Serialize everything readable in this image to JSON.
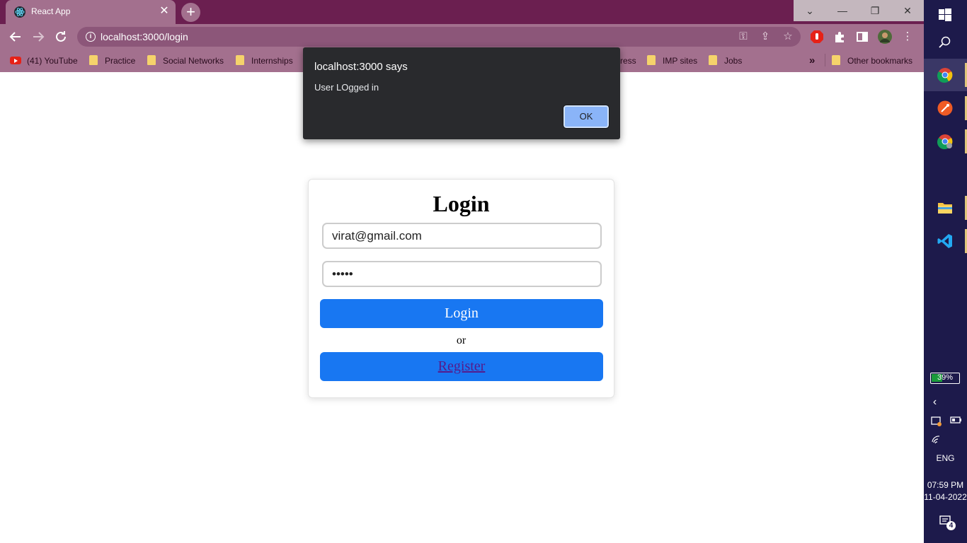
{
  "browser": {
    "tab": {
      "title": "React App",
      "close": "✕"
    },
    "new_tab": "+",
    "window_controls": {
      "tabsearch": "⌄",
      "minimize": "—",
      "restore": "❐",
      "close": "✕"
    },
    "url": "localhost:3000/login",
    "bookmarks": [
      {
        "label": "(41) YouTube",
        "icon": "youtube-icon"
      },
      {
        "label": "Practice",
        "icon": "folder-icon"
      },
      {
        "label": "Social Networks",
        "icon": "folder-icon"
      },
      {
        "label": "Internships",
        "icon": "folder-icon"
      },
      {
        "label": "ress",
        "icon": "folder-icon"
      },
      {
        "label": "IMP sites",
        "icon": "folder-icon"
      },
      {
        "label": "Jobs",
        "icon": "folder-icon"
      }
    ],
    "bookmarks_overflow": "»",
    "other_bookmarks": "Other bookmarks"
  },
  "alert": {
    "title": "localhost:3000 says",
    "message": "User LOgged in",
    "ok_label": "OK"
  },
  "login": {
    "title": "Login",
    "email_value": "virat@gmail.com",
    "password_value": "12345",
    "login_button": "Login",
    "or_text": "or",
    "register_link": "Register"
  },
  "taskbar": {
    "battery": "39%",
    "battery_level": 0.39,
    "language": "ENG",
    "time": "07:59 PM",
    "date": "11-04-2022",
    "notifications": "4"
  },
  "colors": {
    "tabstrip": "#6b1f50",
    "toolbar": "#a3708e",
    "primary": "#1877f2",
    "alert_bg": "#292a2d",
    "taskbar": "#1d1a4b"
  }
}
